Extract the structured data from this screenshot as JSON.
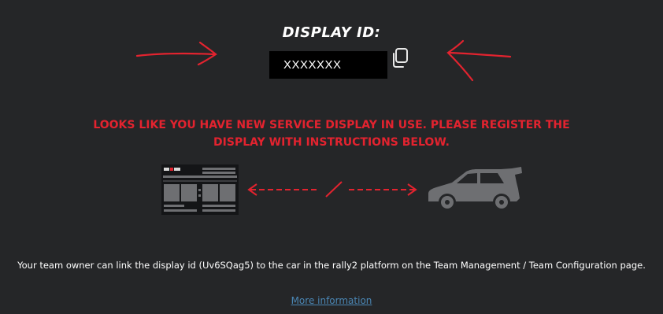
{
  "header": {
    "title": "DISPLAY ID:"
  },
  "display_id": {
    "value": "XXXXXXX"
  },
  "icons": {
    "copy": "copy-icon",
    "display": "display-panel-icon",
    "car": "car-icon",
    "arrows": "red-arrow-icon"
  },
  "warning": {
    "text": "LOOKS LIKE YOU HAVE NEW SERVICE DISPLAY IN USE. PLEASE REGISTER THE DISPLAY WITH INSTRUCTIONS BELOW."
  },
  "instructions": {
    "text": "Your team owner can link the display id (Uv6SQag5) to the car in the rally2 platform on the Team Management / Team Configuration page."
  },
  "more_info": {
    "label": "More information"
  },
  "colors": {
    "background": "#252628",
    "accent_red": "#e3232f",
    "link": "#4a86b4",
    "illustration_gray": "#6e6f72"
  }
}
